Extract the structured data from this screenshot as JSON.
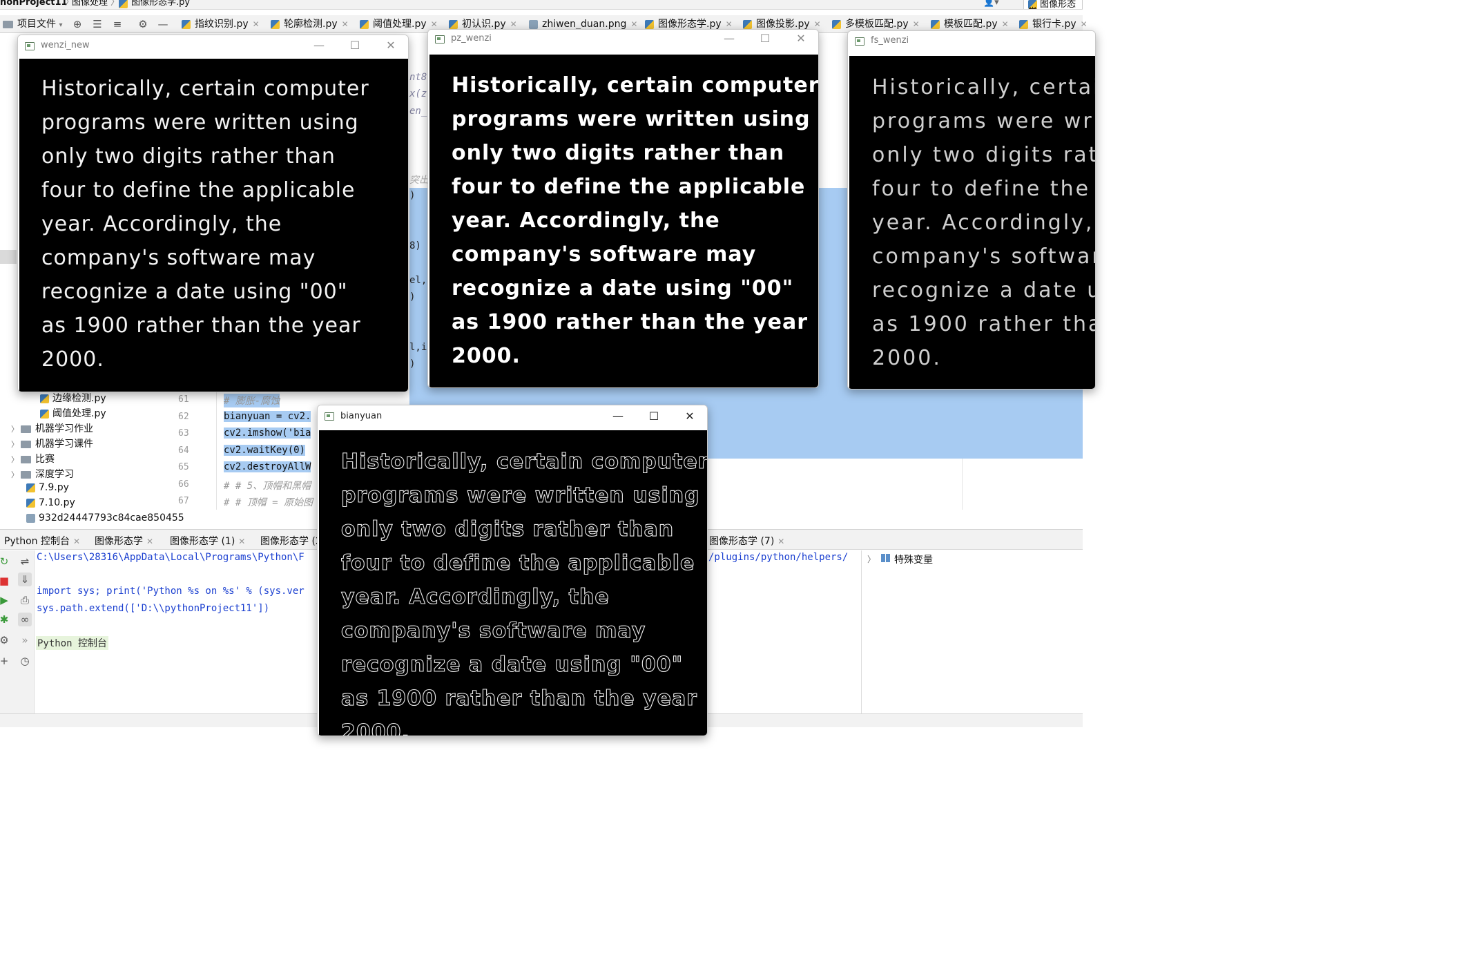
{
  "breadcrumb": {
    "project": "honProject11",
    "folder": "图像处理",
    "file": "图像形态学.py"
  },
  "file_tabs": [
    {
      "label": "指纹识别.py"
    },
    {
      "label": "轮廓检测.py"
    },
    {
      "label": "阈值处理.py"
    },
    {
      "label": "初认识.py"
    },
    {
      "label": "zhiwen_duan.png"
    },
    {
      "label": "图像形态学.py"
    },
    {
      "label": "图像投影.py"
    },
    {
      "label": "多模板匹配.py"
    },
    {
      "label": "模板匹配.py"
    },
    {
      "label": "银行卡.py"
    }
  ],
  "project_panel_label": "项目文件",
  "tree_items": [
    {
      "label": "边缘检测.py"
    },
    {
      "label": "阈值处理.py"
    },
    {
      "label": "机器学习作业"
    },
    {
      "label": "机器学习课件"
    },
    {
      "label": "比赛"
    },
    {
      "label": "深度学习"
    },
    {
      "label": "7.9.py"
    },
    {
      "label": "7.10.py"
    },
    {
      "label": "932d24447793c84cae850455"
    }
  ],
  "code_lines": [
    {
      "num": "61",
      "text": "# 膨胀-腐蚀"
    },
    {
      "num": "62",
      "text": "bianyuan = cv2."
    },
    {
      "num": "63",
      "text": "cv2.imshow('bia"
    },
    {
      "num": "64",
      "text": "cv2.waitKey(0)"
    },
    {
      "num": "65",
      "text": "cv2.destroyAllW"
    },
    {
      "num": "66",
      "text": "# # 5、顶帽和黑帽"
    },
    {
      "num": "67",
      "text": "# # 顶帽 = 原始图"
    }
  ],
  "code_fragments": [
    "nt8",
    "x(z",
    "en_",
    "突出",
    ")",
    "8)",
    "el,",
    ")",
    "l,i",
    ")"
  ],
  "bottom_tabs": [
    {
      "label": "Python 控制台"
    },
    {
      "label": "图像形态学"
    },
    {
      "label": "图像形态学 (1)"
    },
    {
      "label": "图像形态学 (2"
    },
    {
      "label": "图像形态学 (7)"
    }
  ],
  "console": {
    "path": "C:\\Users\\28316\\AppData\\Local\\Programs\\Python\\F",
    "path_tail": "/plugins/python/helpers/",
    "line1": "import sys; print('Python %s on %s' % (sys.ver",
    "line2": "sys.path.extend(['D:\\\\pythonProject11'])",
    "prompt": "Python 控制台"
  },
  "vars_label": "特殊变量",
  "image_text_lines": [
    "Historically, certain computer",
    "programs were written using",
    "only two digits rather than",
    "four to define the applicable",
    "year. Accordingly, the",
    "company's software may",
    "recognize a date using \"00\"",
    "as 1900 rather than the year",
    "2000."
  ],
  "windows": {
    "wenzi": {
      "title": "wenzi_new"
    },
    "pz": {
      "title": "pz_wenzi"
    },
    "fs": {
      "title": "fs_wenzi"
    },
    "by": {
      "title": "bianyuan"
    }
  },
  "window_controls": {
    "minimize": "—",
    "maximize": "☐",
    "close": "✕"
  },
  "colors": {
    "selection": "#a7cbf2",
    "accent": "#4a88c7",
    "canvas": "#000000"
  }
}
